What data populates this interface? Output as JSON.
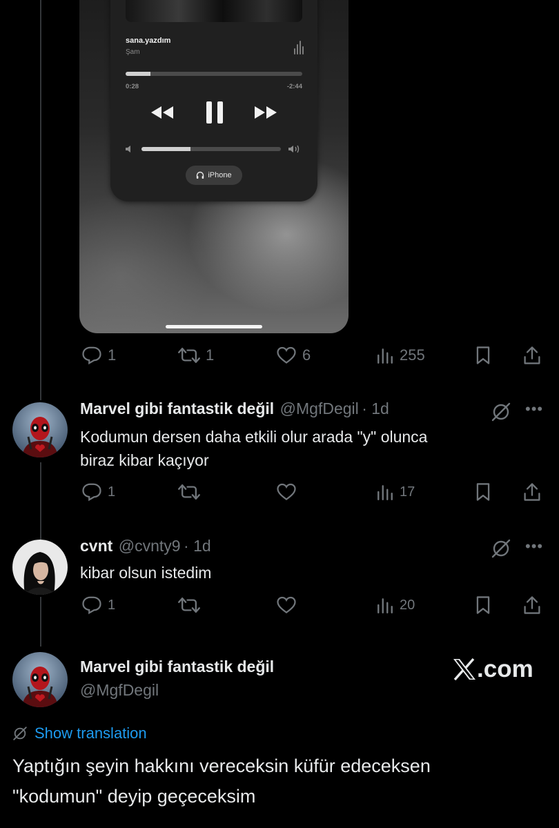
{
  "player": {
    "song_title": "sana.yazdım",
    "artist": "Şam",
    "elapsed": "0:28",
    "remaining": "-2:44",
    "progress": 0.14,
    "volume": 0.35,
    "output_device": "iPhone"
  },
  "tweet_top": {
    "replies": "1",
    "reposts": "1",
    "likes": "6",
    "views": "255"
  },
  "reply1": {
    "name": "Marvel gibi fantastik değil",
    "handle": "@MgfDegil",
    "time": "· 1d",
    "text_line1": "Kodumun dersen daha etkili olur arada \"y\" olunca",
    "text_line2": "biraz kibar kaçıyor",
    "replies": "1",
    "views": "17"
  },
  "reply2": {
    "name": "cvnt",
    "handle": "@cvnty9",
    "time": "· 1d",
    "text": "kibar olsun istedim",
    "replies": "1",
    "views": "20"
  },
  "main_tweet": {
    "name": "Marvel gibi fantastik değil",
    "handle": "@MgfDegil",
    "show_translation": "Show translation",
    "text_line1": "Yaptığın şeyin hakkını vereceksin küfür edeceksen",
    "text_line2": "\"kodumun\" deyip geçeceksim"
  },
  "watermark": {
    "domain": ".com"
  },
  "colors": {
    "background": "#000000",
    "text": "#e7e9ea",
    "muted": "#71767b",
    "link": "#1d9bf0"
  }
}
